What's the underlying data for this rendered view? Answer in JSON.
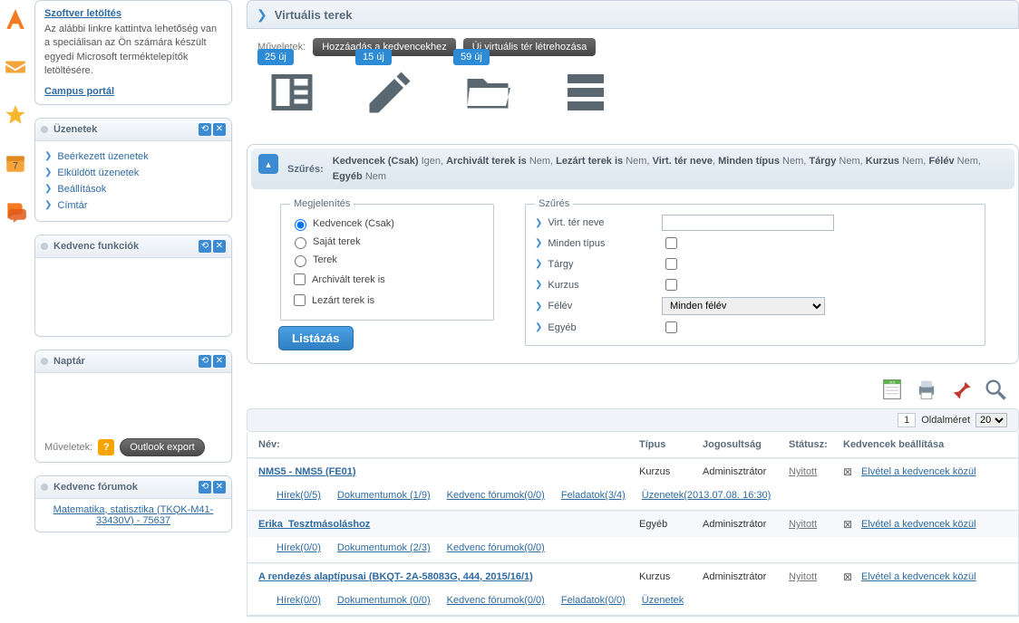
{
  "left": {
    "download_title": "Szoftver letöltés",
    "download_text": "Az alábbi linkre kattintva lehetőség van a speciálisan az Ön számára készült egyedi Microsoft terméktelepítők letöltésére.",
    "campus_link": "Campus portál",
    "messages_title": "Üzenetek",
    "messages_items": [
      "Beérkezett üzenetek",
      "Elküldött üzenetek",
      "Beállítások",
      "Címtár"
    ],
    "fav_title": "Kedvenc funkciók",
    "calendar_title": "Naptár",
    "muveletek": "Műveletek:",
    "outlook_btn": "Outlook export",
    "forums_title": "Kedvenc fórumok",
    "forum_link": "Matematika, statisztika (TKQK-M41-33430V) - 75637"
  },
  "main": {
    "title": "Virtuális terek",
    "ops_label": "Műveletek:",
    "op_fav": "Hozzáadás a kedvencekhez",
    "op_new": "Új virtuális tér létrehozása",
    "badges": [
      "25 új",
      "15 új",
      "59 új"
    ]
  },
  "filter": {
    "label": "Szűrés:",
    "summary_parts": [
      {
        "k": "Kedvencek (Csak)",
        "v": "Igen"
      },
      {
        "k": "Archivált terek is",
        "v": "Nem"
      },
      {
        "k": "Lezárt terek is",
        "v": "Nem"
      },
      {
        "k": "Virt. tér neve",
        "v": ""
      },
      {
        "k": "Minden típus",
        "v": "Nem"
      },
      {
        "k": "Tárgy",
        "v": "Nem"
      },
      {
        "k": "Kurzus",
        "v": "Nem"
      },
      {
        "k": "Félév",
        "v": "Nem"
      },
      {
        "k": "Egyéb",
        "v": "Nem"
      }
    ],
    "display_legend": "Megjelenítés",
    "radios": [
      "Kedvencek (Csak)",
      "Saját terek",
      "Terek"
    ],
    "checks": [
      "Archivált terek is",
      "Lezárt terek is"
    ],
    "list_btn": "Listázás",
    "szures_legend": "Szűrés",
    "fields": [
      "Virt. tér neve",
      "Minden típus",
      "Tárgy",
      "Kurzus",
      "Félév",
      "Egyéb"
    ],
    "felev_sel": "Minden félév"
  },
  "pager": {
    "page": "1",
    "size_label": "Oldalméret",
    "size": "20"
  },
  "thead": [
    "Név:",
    "Típus",
    "Jogosultság",
    "Státusz:",
    "Kedvencek beállítása"
  ],
  "rows": [
    {
      "name": "NMS5 - NMS5 (FE01)",
      "type": "Kurzus",
      "role": "Adminisztrátor",
      "status": "Nyitott",
      "fav": "Elvétel a kedvencek közül",
      "sub": [
        "Hírek(0/5)",
        "Dokumentumok (1/9)",
        "Kedvenc fórumok(0/0)",
        "Feladatok(3/4)",
        "Üzenetek(2013.07.08. 16:30)"
      ]
    },
    {
      "name": "Erika_Tesztmásoláshoz",
      "type": "Egyéb",
      "role": "Adminisztrátor",
      "status": "Nyitott",
      "fav": "Elvétel a kedvencek közül",
      "sub": [
        "Hírek(0/0)",
        "Dokumentumok (2/3)",
        "Kedvenc fórumok(0/0)"
      ]
    },
    {
      "name": "A rendezés alaptípusai (BKQT- 2A-58083G, 444, 2015/16/1)",
      "type": "Kurzus",
      "role": "Adminisztrátor",
      "status": "Nyitott",
      "fav": "Elvétel a kedvencek közül",
      "sub": [
        "Hírek(0/0)",
        "Dokumentumok (0/0)",
        "Kedvenc fórumok(0/0)",
        "Feladatok(0/0)",
        "Üzenetek"
      ]
    }
  ]
}
